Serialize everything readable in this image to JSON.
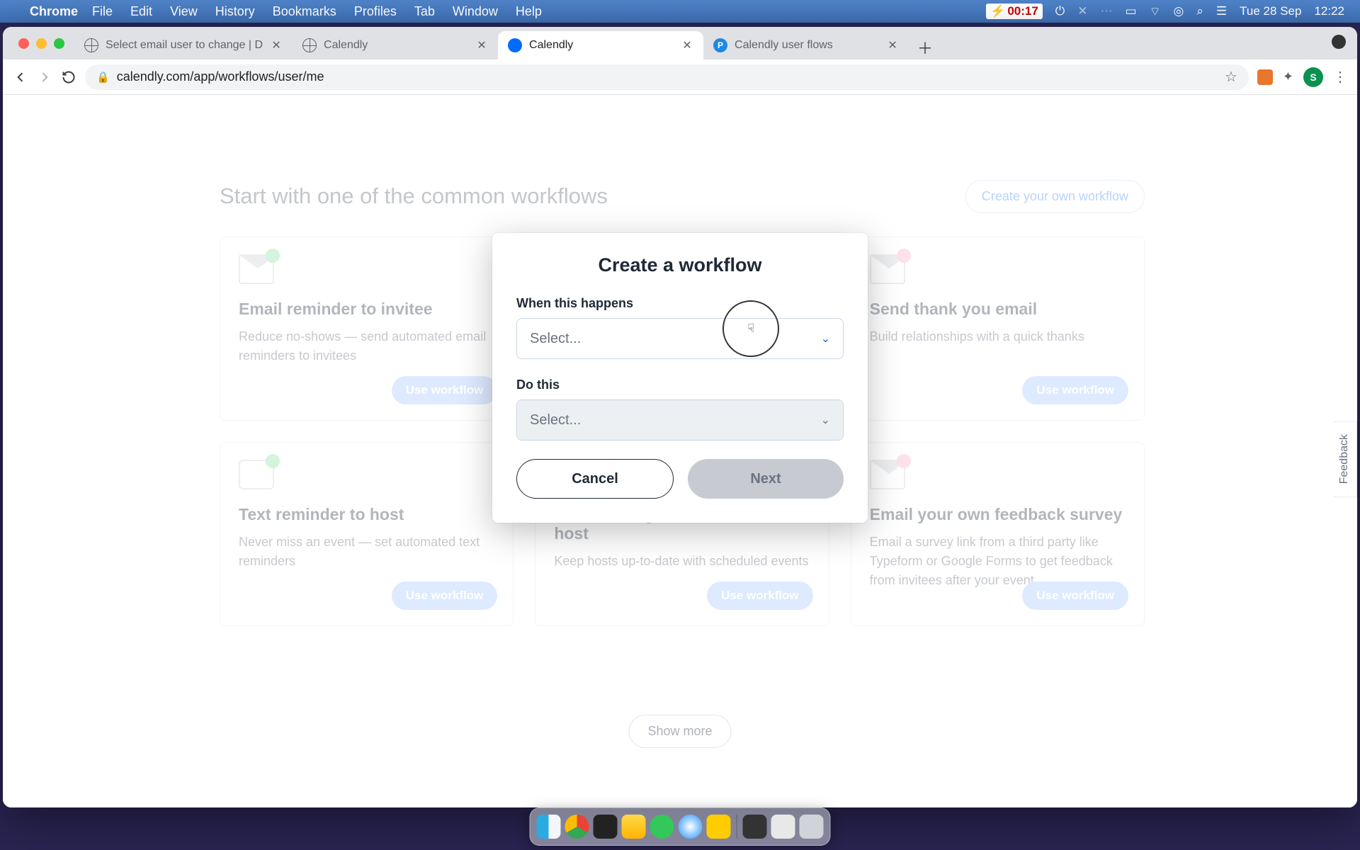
{
  "menubar": {
    "app": "Chrome",
    "items": [
      "File",
      "Edit",
      "View",
      "History",
      "Bookmarks",
      "Profiles",
      "Tab",
      "Window",
      "Help"
    ],
    "timer": "00:17",
    "date": "Tue 28 Sep",
    "time": "12:22"
  },
  "tabs": [
    {
      "title": "Select email user to change | D",
      "active": false,
      "favicon": "globe"
    },
    {
      "title": "Calendly",
      "active": false,
      "favicon": "globe"
    },
    {
      "title": "Calendly",
      "active": true,
      "favicon": "calendly"
    },
    {
      "title": "Calendly user flows",
      "active": false,
      "favicon": "p"
    }
  ],
  "address": {
    "url": "calendly.com/app/workflows/user/me"
  },
  "avatar_initial": "S",
  "page": {
    "heading": "Start with one of the common workflows",
    "create_button": "Create your own workflow",
    "show_more": "Show more",
    "feedback": "Feedback",
    "cards": [
      {
        "title": "Email reminder to invitee",
        "desc": "Reduce no-shows — send automated email reminders to invitees",
        "badge": "green",
        "btn": "Use workflow",
        "icon": "mail"
      },
      {
        "title": "",
        "desc": "",
        "badge": "blue",
        "btn": "",
        "icon": "mail"
      },
      {
        "title": "Send thank you email",
        "desc": "Build relationships with a quick thanks",
        "badge": "pink",
        "btn": "Use workflow",
        "icon": "mail"
      },
      {
        "title": "Text reminder to host",
        "desc": "Never miss an event — set automated text reminders",
        "badge": "green",
        "btn": "Use workflow",
        "icon": "phone"
      },
      {
        "title": "Text booking confirmation to host",
        "desc": "Keep hosts up-to-date with scheduled events",
        "badge": "blue",
        "btn": "Use workflow",
        "icon": "phone"
      },
      {
        "title": "Email your own feedback survey",
        "desc": "Email a survey link from a third party like Typeform or Google Forms to get feedback from invitees after your event",
        "badge": "pink",
        "btn": "Use workflow",
        "icon": "mail"
      }
    ]
  },
  "modal": {
    "title": "Create a workflow",
    "label1": "When this happens",
    "select1": "Select...",
    "label2": "Do this",
    "select2": "Select...",
    "cancel": "Cancel",
    "next": "Next"
  }
}
